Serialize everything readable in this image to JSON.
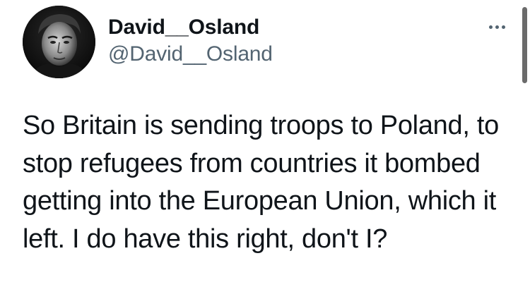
{
  "tweet": {
    "author": {
      "display_name": "David__Osland",
      "handle": "@David__Osland",
      "avatar_icon": "profile-photo"
    },
    "more_icon": "more-horizontal-icon",
    "text": "So Britain is sending troops to Poland, to stop refugees from countries it bombed getting into the European Union, which it left. I do have this right, don't I?"
  },
  "colors": {
    "text_primary": "#0f1419",
    "text_secondary": "#536471",
    "background": "#ffffff"
  }
}
